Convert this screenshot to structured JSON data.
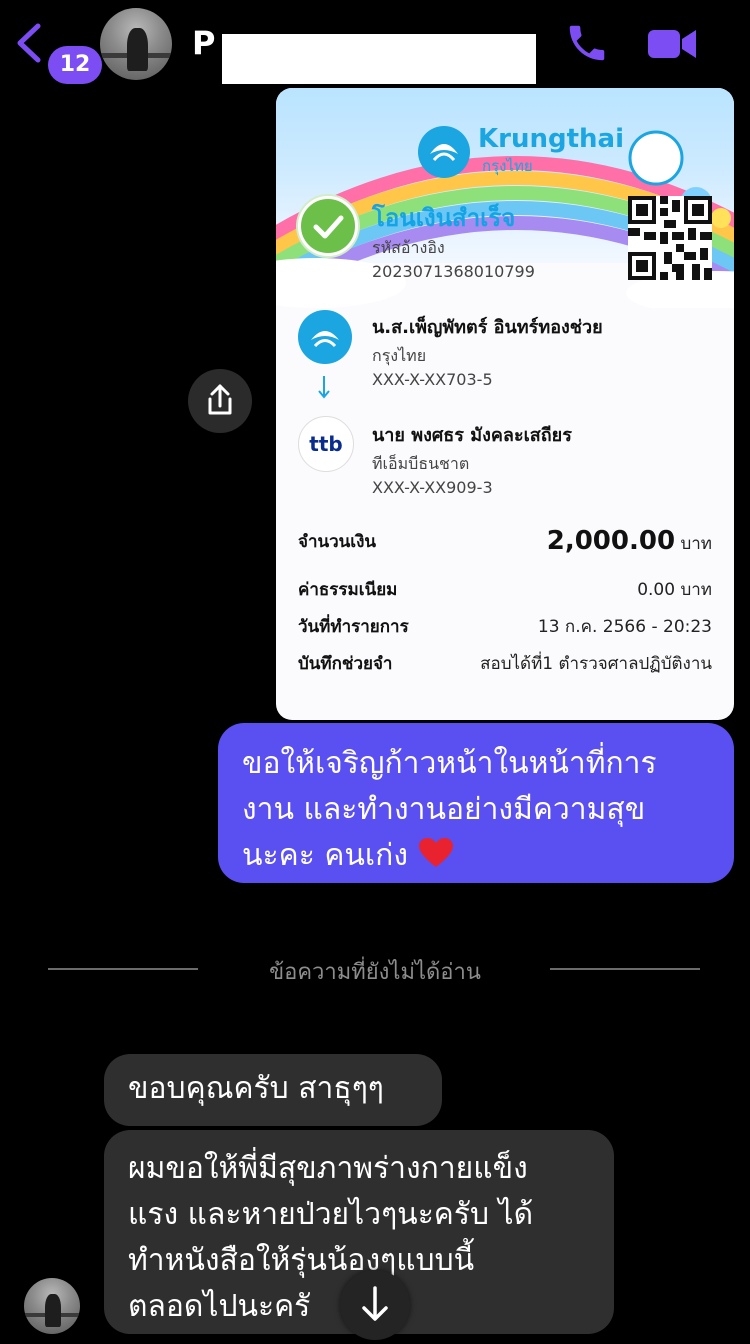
{
  "header": {
    "unread_count": "12",
    "contact_name": "P"
  },
  "receipt": {
    "bank_brand_en": "Krungthai",
    "bank_brand_th": "กรุงไทย",
    "status": "โอนเงินสำเร็จ",
    "ref_label": "รหัสอ้างอิง",
    "ref_number": "2023071368010799",
    "sender": {
      "name": "น.ส.เพ็ญพัทตร์ อินทร์ทองช่วย",
      "bank": "กรุงไทย",
      "account": "XXX-X-XX703-5"
    },
    "receiver": {
      "logo_text": "ttb",
      "name": "นาย พงศธร มังคละเสถียร",
      "bank": "ทีเอ็มบีธนชาต",
      "account": "XXX-X-XX909-3"
    },
    "rows": {
      "amount_label": "จำนวนเงิน",
      "amount_value": "2,000.00",
      "amount_unit": "บาท",
      "fee_label": "ค่าธรรมเนียม",
      "fee_value": "0.00 บาท",
      "date_label": "วันที่ทำรายการ",
      "date_value": "13 ก.ค. 2566 - 20:23",
      "memo_label": "บันทึกช่วยจำ",
      "memo_value": "สอบได้ที่1 ตำรวจศาลปฏิบัติงาน"
    }
  },
  "messages": {
    "sent_1": "ขอให้เจริญก้าวหน้าในหน้าที่การงาน และทำงานอย่างมีความสุขนะคะ คนเก่ง",
    "sent_1_lines": [
      "ขอให้เจริญก้าวหน้าในหน้าที่การ",
      "งาน และทำงานอย่างมีความสุข",
      "นะคะ คนเก่ง"
    ],
    "unread_divider": "ข้อความที่ยังไม่ได้อ่าน",
    "received_1": "ขอบคุณครับ สาธุๆๆ",
    "received_2_lines": [
      "ผมขอให้พี่มีสุขภาพร่างกายแข็ง",
      "แรง และหายป่วยไวๆนะครับ ได้",
      "ทำหนังสือให้รุ่นน้องๆแบบนี้",
      "ตลอดไปนะครั"
    ]
  },
  "colors": {
    "accent": "#7b4df2",
    "sent_bubble": "#5a4ff0",
    "received_bubble": "#2f2f2f",
    "ktb_blue": "#1ba5e1",
    "success_green": "#6cc04a"
  },
  "icons": {
    "back": "chevron-left-icon",
    "call": "phone-icon",
    "video": "video-camera-icon",
    "share": "share-icon",
    "scroll": "arrow-down-icon",
    "heart": "red-heart-emoji"
  }
}
